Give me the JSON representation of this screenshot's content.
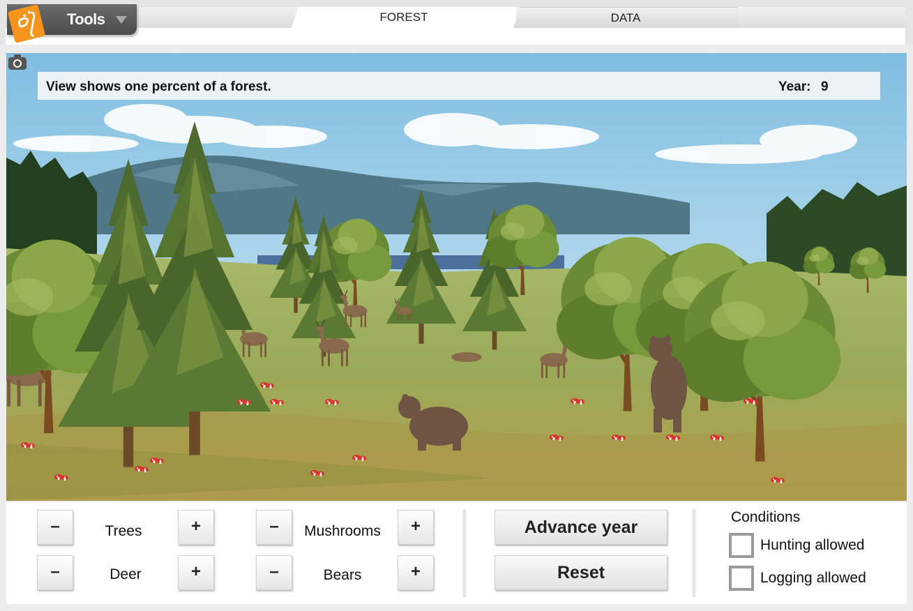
{
  "header": {
    "tools_label": "Tools",
    "tabs": [
      {
        "label": "FOREST",
        "active": true
      },
      {
        "label": "DATA",
        "active": false
      }
    ]
  },
  "scene": {
    "info_text": "View shows one percent of a forest.",
    "year_label": "Year:",
    "year_value": "9"
  },
  "controls": {
    "minus_glyph": "–",
    "plus_glyph": "+",
    "counters": [
      {
        "label": "Trees"
      },
      {
        "label": "Deer"
      },
      {
        "label": "Mushrooms"
      },
      {
        "label": "Bears"
      }
    ],
    "advance_label": "Advance year",
    "reset_label": "Reset",
    "conditions_title": "Conditions",
    "hunting_label": "Hunting allowed",
    "logging_label": "Logging allowed",
    "hunting_checked": false,
    "logging_checked": false
  },
  "icons": {
    "logo": "el-logo-icon",
    "tools_caret": "caret-down-icon",
    "camera": "camera-icon"
  },
  "colors": {
    "logo_orange": "#f7941d",
    "sky": "#a9d2ea",
    "grass": "#9fae5a"
  }
}
